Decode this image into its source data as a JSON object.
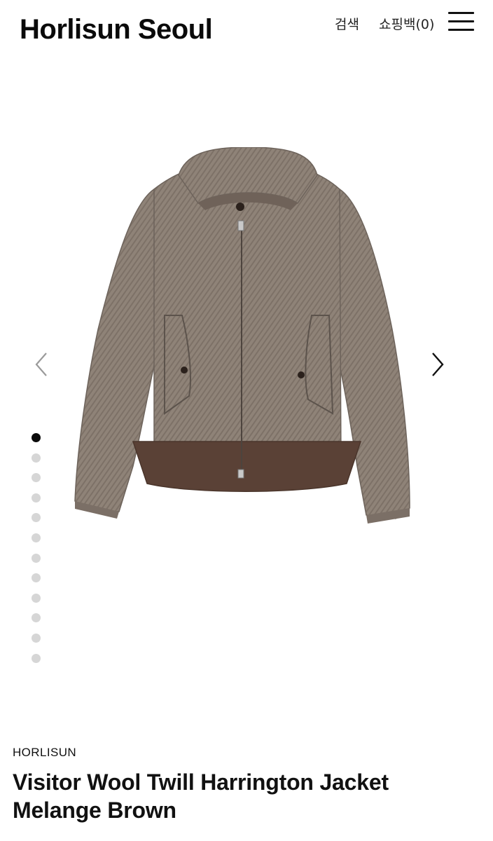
{
  "header": {
    "logo": "Horlisun Seoul",
    "search_label": "검색",
    "bag_label": "쇼핑백(0)",
    "menu_icon": "hamburger-menu-icon"
  },
  "gallery": {
    "image_description_icon": "jacket-product-image",
    "prev_icon": "chevron-left-icon",
    "next_icon": "chevron-right-icon",
    "slide_count": 12,
    "active_slide": 1
  },
  "product": {
    "brand": "HORLISUN",
    "title_line1": "Visitor Wool Twill Harrington Jacket",
    "title_line2": "Melange Brown"
  },
  "colors": {
    "fabric": "#8f8378",
    "rib": "#5a4136",
    "dot_active": "#0a0a0a",
    "dot_inactive": "#d6d6d6"
  }
}
